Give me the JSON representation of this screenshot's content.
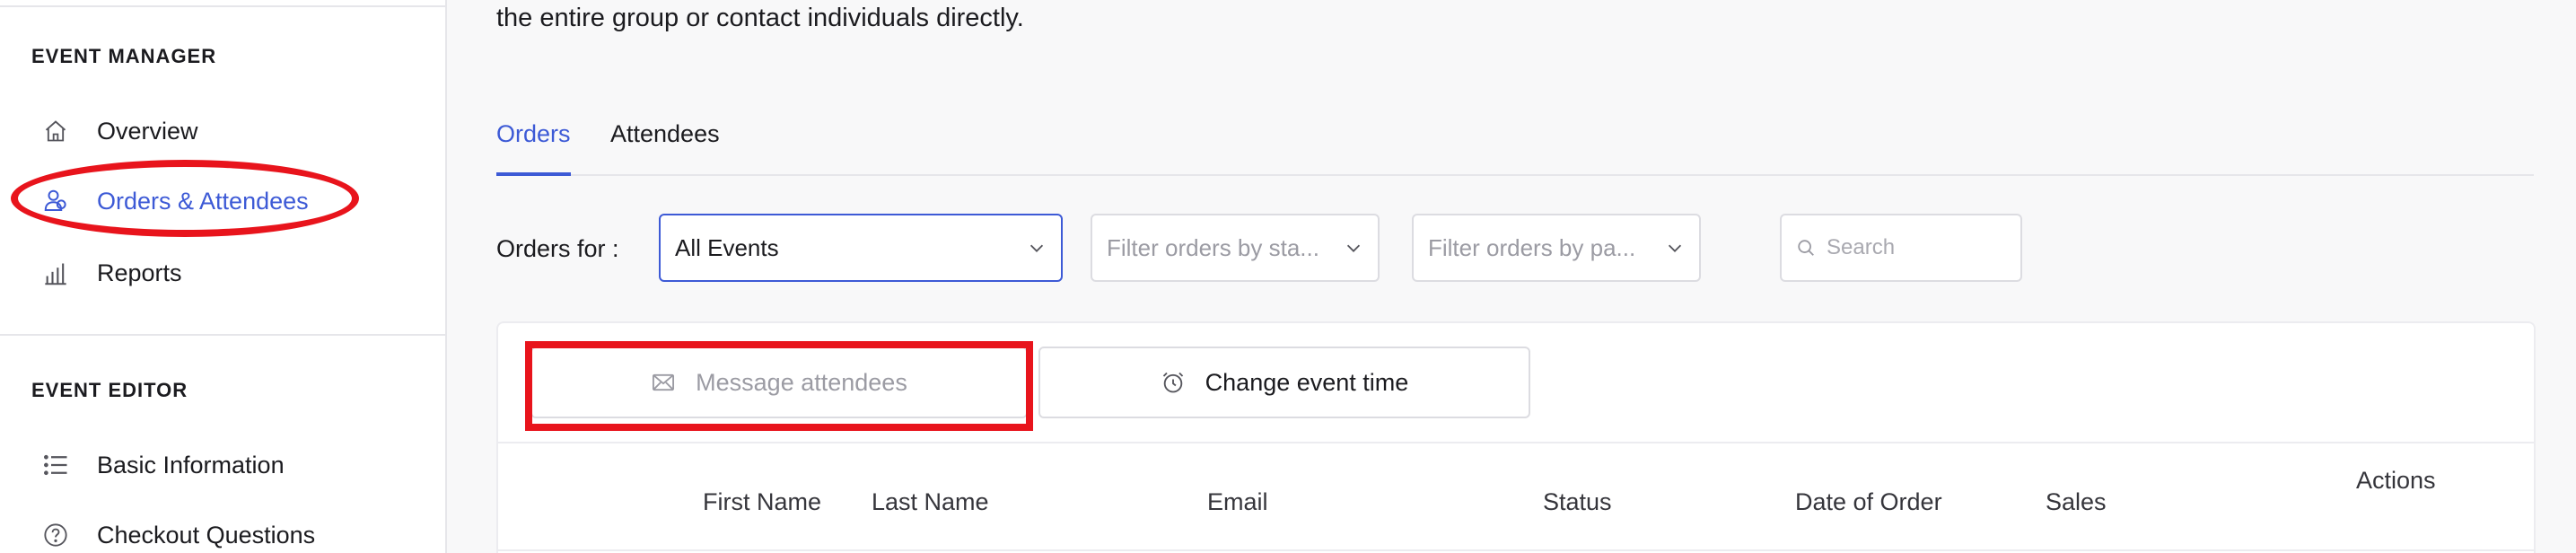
{
  "sidebar": {
    "event_manager_heading": "EVENT MANAGER",
    "event_manager_items": [
      {
        "label": "Overview",
        "icon": "home-icon",
        "active": false
      },
      {
        "label": "Orders & Attendees",
        "icon": "attendees-icon",
        "active": true
      },
      {
        "label": "Reports",
        "icon": "bar-chart-icon",
        "active": false
      }
    ],
    "event_editor_heading": "EVENT EDITOR",
    "event_editor_items": [
      {
        "label": "Basic Information",
        "icon": "list-icon"
      },
      {
        "label": "Checkout Questions",
        "icon": "question-circle-icon"
      }
    ]
  },
  "main": {
    "intro_text": "the entire group or contact individuals directly.",
    "tabs": [
      {
        "label": "Orders",
        "active": true
      },
      {
        "label": "Attendees",
        "active": false
      }
    ],
    "filters": {
      "orders_for_label": "Orders for :",
      "event_select_value": "All Events",
      "status_filter_placeholder": "Filter orders by sta...",
      "payment_filter_placeholder": "Filter orders by pa...",
      "search_placeholder": "Search"
    },
    "actions": {
      "message_attendees": "Message attendees",
      "change_event_time": "Change event time"
    },
    "table": {
      "columns": [
        "First Name",
        "Last Name",
        "Email",
        "Status",
        "Date of Order",
        "Sales",
        "Actions"
      ]
    }
  },
  "colors": {
    "accent": "#3d5ad6",
    "annotation": "#e8141c",
    "text": "#1b1b1f",
    "muted": "#9b9ba3"
  }
}
